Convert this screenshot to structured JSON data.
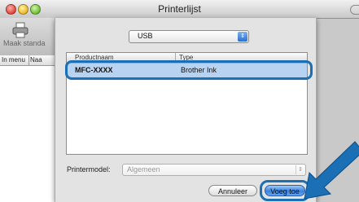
{
  "window": {
    "title": "Printerlijst"
  },
  "toolbar": {
    "make_default_label": "Maak standa",
    "icon": "printer-icon"
  },
  "back_list": {
    "columns": [
      "In menu",
      "Naa"
    ]
  },
  "sheet": {
    "connection_select": "USB",
    "printer_list": {
      "columns": [
        "Productnaam",
        "Type"
      ],
      "rows": [
        {
          "name": "MFC-XXXX",
          "kind": "Brother Ink",
          "selected": true
        }
      ]
    },
    "printer_model_label": "Printermodel:",
    "printer_model_value": "Algemeen",
    "cancel_label": "Annuleer",
    "add_label": "Voeg toe"
  },
  "colors": {
    "highlight": "#1a6fb5",
    "selection": "#b8d3f1",
    "arrow": "#1a6fb5"
  }
}
